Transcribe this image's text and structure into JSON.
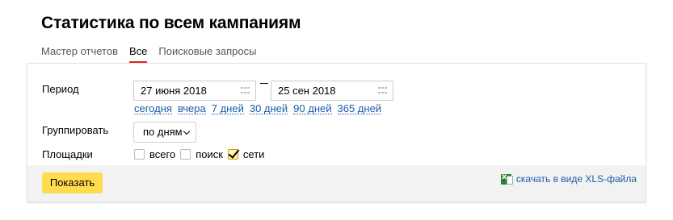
{
  "page": {
    "title": "Статистика по всем кампаниям"
  },
  "tabs": [
    {
      "label": "Мастер отчетов",
      "active": false
    },
    {
      "label": "Все",
      "active": true
    },
    {
      "label": "Поисковые запросы",
      "active": false
    }
  ],
  "period": {
    "label": "Период",
    "start": "27 июня 2018",
    "end": "25 сен 2018",
    "presets": [
      "сегодня",
      "вчера",
      "7 дней",
      "30 дней",
      "90 дней",
      "365 дней"
    ]
  },
  "grouping": {
    "label": "Группировать",
    "value": "по дням"
  },
  "platforms": {
    "label": "Площадки",
    "options": [
      {
        "label": "всего",
        "checked": false
      },
      {
        "label": "поиск",
        "checked": false
      },
      {
        "label": "сети",
        "checked": true
      }
    ]
  },
  "footer": {
    "show_label": "Показать",
    "download_label": "скачать в виде XLS-файла"
  },
  "colors": {
    "accent_tab": "#e5231f",
    "button_yellow": "#ffdb4d",
    "link_blue": "#1a5caa",
    "footer_bg": "#f2f2f2"
  }
}
